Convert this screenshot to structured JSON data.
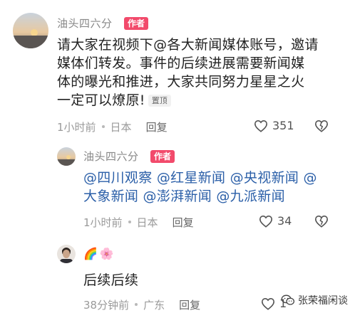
{
  "comments": [
    {
      "author": "油头四六分",
      "badge": "作者",
      "text": "请大家在视频下@各大新闻媒体账号，邀请媒体们转发。事件的后续进展需要新闻媒体的曝光和推进，大家共同努力星星之火一定可以燎原!",
      "lines": [
        "请大家在视频下@各大新闻媒体账号，邀请",
        "媒体们转发。事件的后续进展需要新闻媒",
        "体的曝光和推进，大家共同努力星星之火",
        "一定可以燎原!"
      ],
      "pinned_label": "置顶",
      "time": "1小时前",
      "location": "日本",
      "reply_label": "回复",
      "likes": "351"
    },
    {
      "author": "油头四六分",
      "badge": "作者",
      "mentions_line1": "@四川观察 @红星新闻 @央视新闻 @",
      "mentions_line2": "大象新闻 @澎湃新闻 @九派新闻",
      "time": "1小时前",
      "location": "日本",
      "reply_label": "回复",
      "likes": "34"
    },
    {
      "author_emojis": "🌈🌸",
      "text": "后续后续",
      "time": "38分钟前",
      "location": "广东",
      "reply_label": "回复",
      "likes": "1"
    }
  ],
  "watermark": "张荣福闲谈",
  "colors": {
    "badge": "#f24a6b",
    "mention": "#2b5fa8",
    "meta": "#9a9a9a"
  },
  "icons": {
    "like": "heart-outline-icon",
    "dislike": "broken-heart-icon",
    "watermark": "wechat-icon"
  }
}
